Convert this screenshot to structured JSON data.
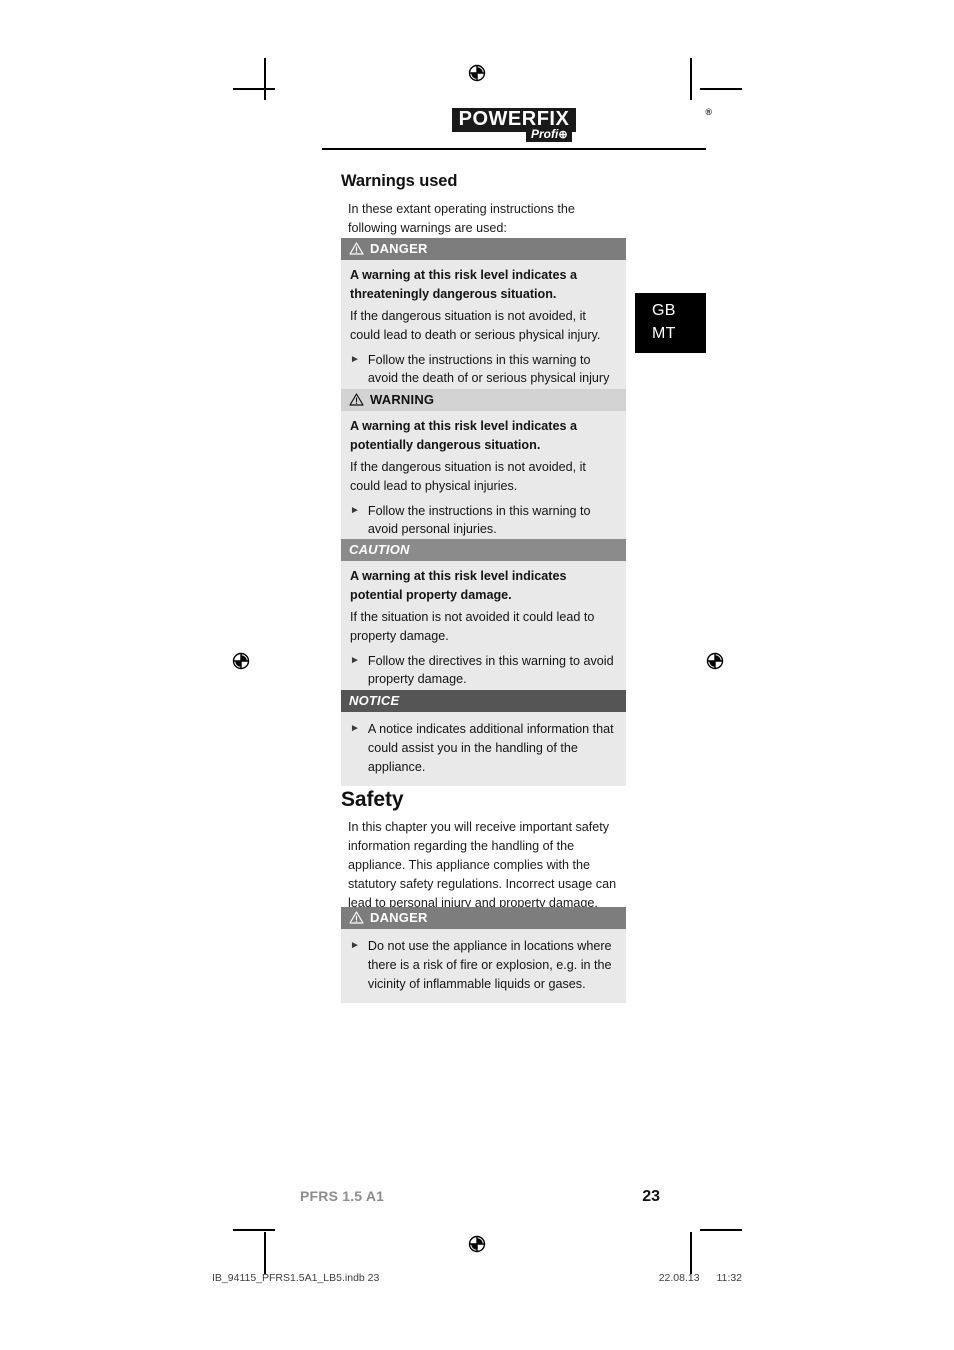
{
  "brand": {
    "logo_text": "POWERFIX",
    "logo_registered": "®",
    "logo_sub": "Profi",
    "logo_sub_symbol": "⊕"
  },
  "language_tab": {
    "line1": "GB",
    "line2": "MT"
  },
  "sections": [
    {
      "title": "Warnings used",
      "intro": "In these extant operating instructions the following warnings are used:"
    },
    {
      "title": "Safety",
      "intro": "In this chapter you will receive important safety information regarding the handling of the appliance. This appliance complies with the statutory safety regulations. Incorrect usage can lead to personal injury and property damage."
    }
  ],
  "warning_boxes": [
    {
      "level": "DANGER",
      "style": "danger",
      "icon": "warning-triangle-icon",
      "lead": "A warning at this risk level indicates a threateningly dangerous situation.",
      "plain": "If the dangerous situation is not avoided, it could lead to death or serious physical injury.",
      "bullet": "Follow the instructions in this warning to avoid the death of or serious physical injury to people."
    },
    {
      "level": "WARNING",
      "style": "warning",
      "icon": "warning-triangle-icon",
      "lead": "A warning at this risk level indicates a potentially dangerous situation.",
      "plain": "If the dangerous situation is not avoided, it could lead to physical injuries.",
      "bullet": "Follow the instructions in this warning to avoid personal injuries."
    },
    {
      "level": "CAUTION",
      "style": "caution",
      "icon": null,
      "lead": "A warning at this risk level indicates potential property damage.",
      "plain": "If the situation is not avoided it could lead to property damage.",
      "bullet": "Follow the directives in this warning to avoid property damage."
    },
    {
      "level": "NOTICE",
      "style": "notice",
      "icon": null,
      "lead": null,
      "plain": null,
      "bullet": "A notice indicates additional information that could assist you in the handling of the appliance."
    },
    {
      "level": "DANGER",
      "style": "danger",
      "icon": "warning-triangle-icon",
      "lead": null,
      "plain": null,
      "bullet": "Do not use the appliance in locations where there is a risk of fire or explosion, e.g. in the vicinity of inflammable liquids or gases."
    }
  ],
  "footer": {
    "model": "PFRS 1.5 A1",
    "page_number": "23"
  },
  "print_info": {
    "file": "IB_94115_PFRS1.5A1_LB5.indb   23",
    "date": "22.08.13",
    "time": "11:32"
  },
  "colors": {
    "danger_bar": "#7d7d7d",
    "warning_bar": "#d3d3d3",
    "caution_bar": "#8b8b8b",
    "notice_bar": "#555555",
    "box_body": "#e9e9e9",
    "lang_tab": "#000000"
  }
}
